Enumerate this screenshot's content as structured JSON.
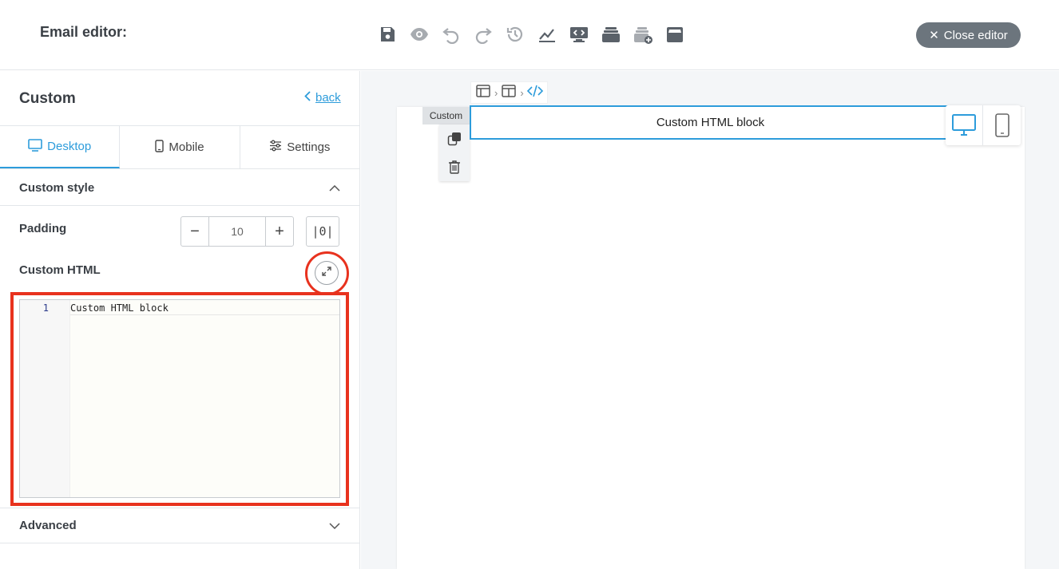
{
  "header": {
    "title": "Email editor:",
    "close_label": "Close editor",
    "toolbar_icons": [
      "save-icon",
      "preview-icon",
      "undo-icon",
      "redo-icon",
      "history-icon",
      "stats-icon",
      "code-view-icon",
      "modules-icon",
      "save-module-icon",
      "store-icon"
    ]
  },
  "sidebar": {
    "title": "Custom",
    "back_label": "back",
    "tabs": [
      {
        "label": "Desktop",
        "icon": "desktop-icon",
        "active": true
      },
      {
        "label": "Mobile",
        "icon": "mobile-icon",
        "active": false
      },
      {
        "label": "Settings",
        "icon": "sliders-icon",
        "active": false
      }
    ],
    "custom_style_label": "Custom style",
    "padding_label": "Padding",
    "padding_value": "10",
    "padding_toggle": "|0|",
    "custom_html_label": "Custom HTML",
    "code": {
      "line_numbers": [
        "1"
      ],
      "lines": [
        "Custom HTML block"
      ]
    },
    "advanced_label": "Advanced"
  },
  "canvas": {
    "block_tag": "Custom",
    "block_text": "Custom HTML block"
  },
  "colors": {
    "accent": "#2d9cdb",
    "highlight": "#e8321e",
    "close_button": "#6c757d"
  }
}
